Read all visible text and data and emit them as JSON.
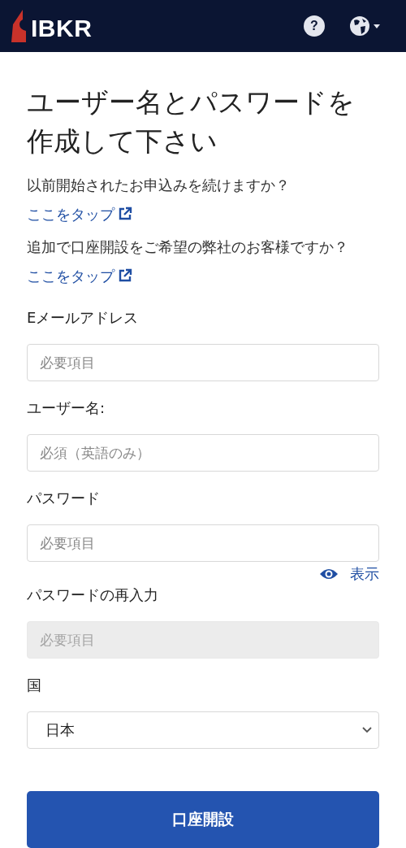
{
  "header": {
    "logo": "IBKR",
    "help_label": "?"
  },
  "title": "ユーザー名とパスワードを作成して下さい",
  "notes": [
    {
      "text": "以前開始されたお申込みを続けますか？ ",
      "link": "ここをタップ"
    },
    {
      "text": "追加で口座開設をご希望の弊社のお客様ですか？ ",
      "link": "ここをタップ"
    }
  ],
  "fields": [
    {
      "kind": "text",
      "label": "Eメールアドレス",
      "placeholder": "必要項目",
      "disabled": false
    },
    {
      "kind": "text",
      "label": "ユーザー名:",
      "placeholder": "必須（英語のみ）",
      "disabled": false
    },
    {
      "kind": "password",
      "label": "パスワード",
      "placeholder": "必要項目",
      "disabled": false,
      "toggle": "表示"
    },
    {
      "kind": "password",
      "label": "パスワードの再入力",
      "placeholder": "必要項目",
      "disabled": true
    },
    {
      "kind": "select",
      "label": "国",
      "value": "日本"
    }
  ],
  "submit": "口座開設"
}
